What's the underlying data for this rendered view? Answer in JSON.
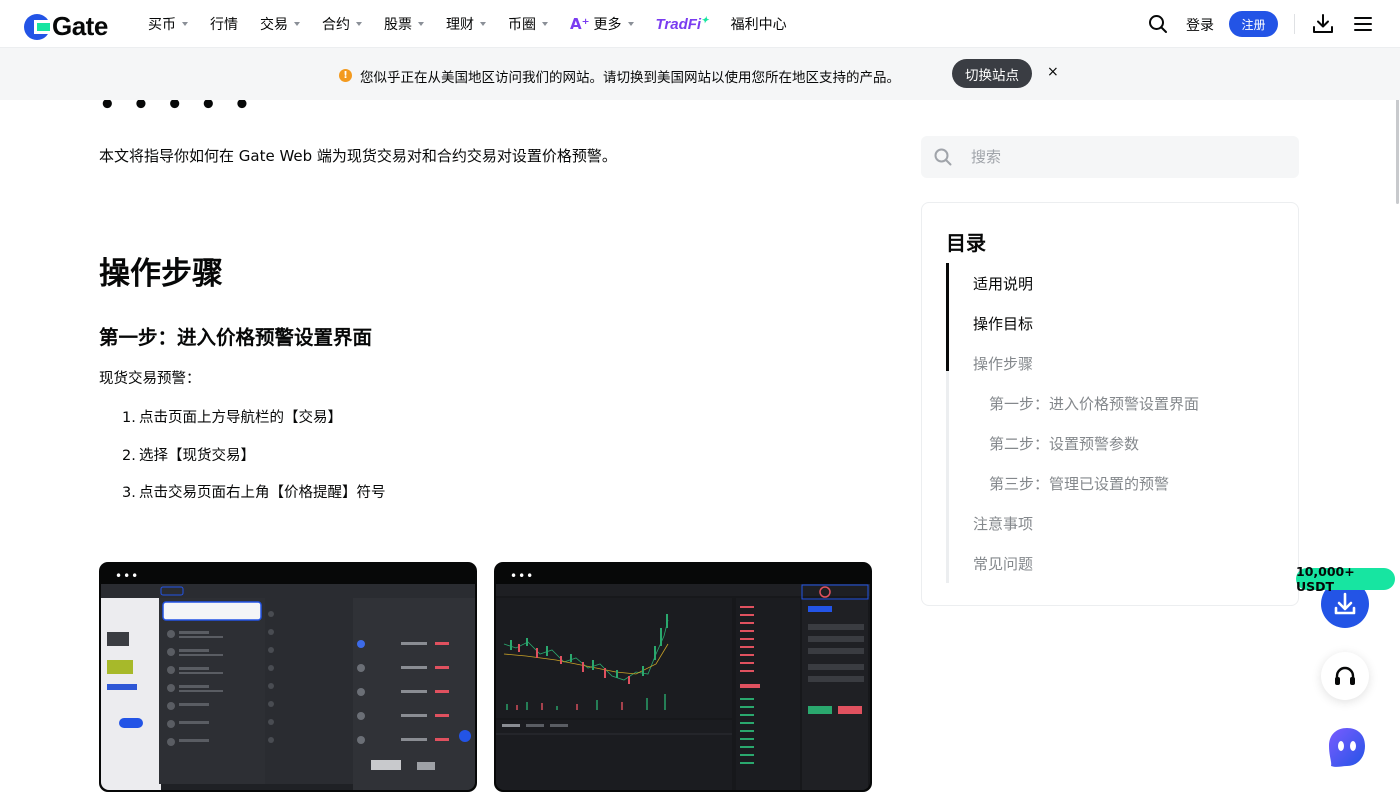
{
  "header": {
    "logo_text": "Gate",
    "nav": [
      {
        "label": "买币",
        "caret": true
      },
      {
        "label": "行情",
        "caret": false
      },
      {
        "label": "交易",
        "caret": true
      },
      {
        "label": "合约",
        "caret": true
      },
      {
        "label": "股票",
        "caret": true
      },
      {
        "label": "理财",
        "caret": true
      },
      {
        "label": "币圈",
        "caret": true
      }
    ],
    "more_label": "更多",
    "tradfi_label": "TradFi",
    "welfare_label": "福利中心",
    "login_label": "登录",
    "register_label": "注册"
  },
  "banner": {
    "text": "您似乎正在从美国地区访问我们的网站。请切换到美国网站以使用您所在地区支持的产品。",
    "button_label": "切换站点",
    "close_label": "×"
  },
  "article": {
    "intro": "本文将指导你如何在 Gate Web 端为现货交易对和合约交易对设置价格预警。",
    "section_title": "操作步骤",
    "step_title": "第一步：进入价格预警设置界面",
    "sub_title": "现货交易预警：",
    "steps": [
      {
        "num": "1.",
        "text": "点击页面上方导航栏的【交易】"
      },
      {
        "num": "2.",
        "text": "选择【现货交易】"
      },
      {
        "num": "3.",
        "text": "点击交易页面右上角【价格提醒】符号"
      }
    ],
    "screenshot_dots": "•••"
  },
  "sidebar": {
    "search_placeholder": "搜索",
    "toc_title": "目录",
    "toc_items": [
      {
        "label": "适用说明",
        "active": true,
        "level": 1
      },
      {
        "label": "操作目标",
        "active": true,
        "level": 1
      },
      {
        "label": "操作步骤",
        "active": false,
        "level": 1
      },
      {
        "label": "第一步：进入价格预警设置界面",
        "active": false,
        "level": 2
      },
      {
        "label": "第二步：设置预警参数",
        "active": false,
        "level": 2
      },
      {
        "label": "第三步：管理已设置的预警",
        "active": false,
        "level": 2
      },
      {
        "label": "注意事项",
        "active": false,
        "level": 1
      },
      {
        "label": "常见问题",
        "active": false,
        "level": 1
      }
    ]
  },
  "floating": {
    "badge": "10,000+ USDT"
  },
  "colors": {
    "brand_blue": "#2354e6",
    "brand_green": "#17e5a1",
    "warning": "#f39a1f"
  }
}
